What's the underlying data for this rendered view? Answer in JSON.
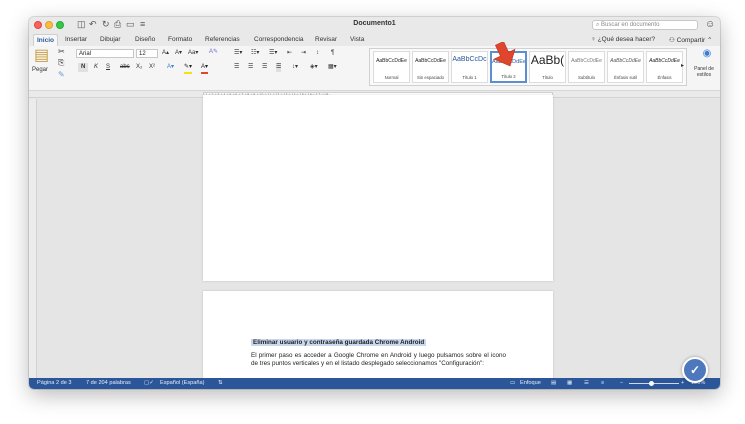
{
  "window": {
    "title": "Documento1"
  },
  "quick_access": {
    "icons": [
      "sidebar-icon",
      "undo-icon",
      "redo-icon",
      "print-icon",
      "save-icon",
      "more-icon"
    ]
  },
  "search": {
    "placeholder": "Buscar en documento"
  },
  "tabs": [
    {
      "label": "Inicio",
      "active": true
    },
    {
      "label": "Insertar"
    },
    {
      "label": "Dibujar"
    },
    {
      "label": "Diseño"
    },
    {
      "label": "Formato"
    },
    {
      "label": "Referencias"
    },
    {
      "label": "Correspondencia"
    },
    {
      "label": "Revisar"
    },
    {
      "label": "Vista"
    }
  ],
  "tell_me": "¿Qué desea hacer?",
  "share": "Compartir",
  "ribbon": {
    "paste": "Pegar",
    "font_name": "Arial",
    "font_size": "12",
    "bold": "N",
    "italic": "K",
    "underline": "S",
    "strike": "abc",
    "subscript": "X₂",
    "superscript": "X²",
    "styles": [
      {
        "sample": "AaBbCcDdEe",
        "name": "Normal"
      },
      {
        "sample": "AaBbCcDdEe",
        "name": "Sin espaciado"
      },
      {
        "sample": "AaBbCcDc",
        "name": "Título 1"
      },
      {
        "sample": "AaBbCcDdEe",
        "name": "Título 2",
        "selected": true
      },
      {
        "sample": "AaBb(",
        "name": "Título"
      },
      {
        "sample": "AaBbCcDdEe",
        "name": "Subtítulo"
      },
      {
        "sample": "AaBbCcDdEe",
        "name": "Énfasis sutil"
      },
      {
        "sample": "AaBbCcDdEe",
        "name": "Énfasis"
      }
    ],
    "styles_pane": "Panel de estilos"
  },
  "document": {
    "heading": "Eliminar usuario y contraseña guardada Chrome Android",
    "paragraph": "El primer paso es acceder a Google Chrome en Android y luego pulsamos sobre el icono de tres puntos verticales y en el listado desplegado seleccionamos \"Configuración\":"
  },
  "status": {
    "page": "Página 2 de 3",
    "words": "7 de 204 palabras",
    "language": "Español (España)",
    "focus": "Enfoque",
    "zoom": "120%"
  },
  "colors": {
    "accent": "#2b579a",
    "highlight": "#c9d7ef",
    "arrow": "#e0452e"
  }
}
